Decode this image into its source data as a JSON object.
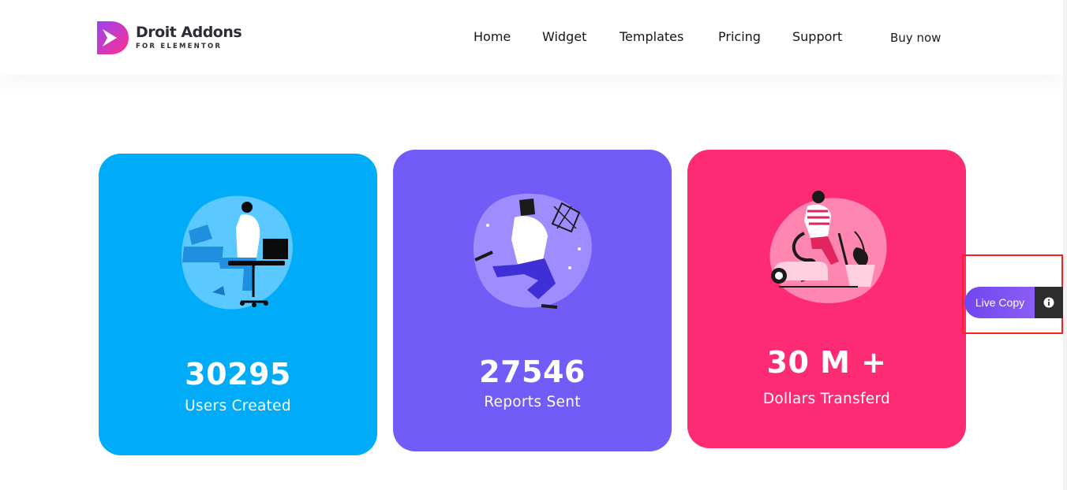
{
  "brand": {
    "name": "Droit Addons",
    "subtitle": "FOR ELEMENTOR",
    "logo_icon": "droit-logo-icon",
    "colors": {
      "gradient_start": "#9a44f0",
      "gradient_end": "#ff2f8d"
    }
  },
  "nav": {
    "items": [
      {
        "label": "Home"
      },
      {
        "label": "Widget"
      },
      {
        "label": "Templates"
      },
      {
        "label": "Pricing"
      },
      {
        "label": "Support"
      }
    ],
    "cta": "Buy now"
  },
  "stats": [
    {
      "value": "30295",
      "label": "Users Created",
      "color": "#00acf7",
      "illustration": "person-at-desk-illustration"
    },
    {
      "value": "27546",
      "label": "Reports Sent",
      "color": "#715cf8",
      "illustration": "person-with-net-illustration"
    },
    {
      "value": "30 M +",
      "label": "Dollars Transferd",
      "color": "#fc2b74",
      "illustration": "person-vacuuming-illustration"
    }
  ],
  "live_copy": {
    "label": "Live Copy",
    "icon": "info-icon",
    "colors": {
      "button": "#7a4ff2",
      "info_bg": "#2d2d2d",
      "highlight_border": "#ff1e1e"
    }
  }
}
